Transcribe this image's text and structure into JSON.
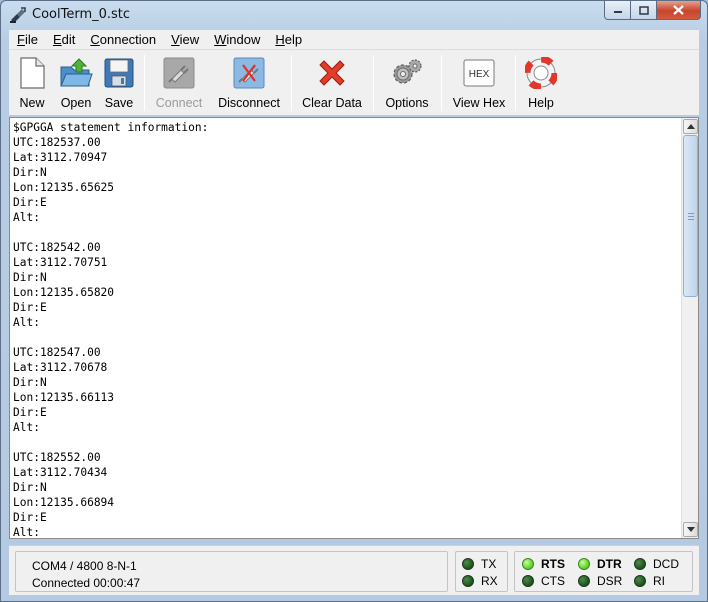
{
  "window": {
    "title": "CoolTerm_0.stc"
  },
  "menu": [
    {
      "underline": "F",
      "rest": "ile"
    },
    {
      "underline": "E",
      "rest": "dit"
    },
    {
      "underline": "C",
      "rest": "onnection"
    },
    {
      "underline": "V",
      "rest": "iew"
    },
    {
      "underline": "W",
      "rest": "indow"
    },
    {
      "underline": "H",
      "rest": "elp"
    }
  ],
  "toolbar": {
    "new": "New",
    "open": "Open",
    "save": "Save",
    "connect": "Connect",
    "disconnect": "Disconnect",
    "clear_data": "Clear Data",
    "options": "Options",
    "view_hex": "View Hex",
    "view_hex_icon_text": "HEX",
    "help": "Help"
  },
  "terminal": {
    "text": "$GPGGA statement information:\nUTC:182537.00\nLat:3112.70947\nDir:N\nLon:12135.65625\nDir:E\nAlt:\n\nUTC:182542.00\nLat:3112.70751\nDir:N\nLon:12135.65820\nDir:E\nAlt:\n\nUTC:182547.00\nLat:3112.70678\nDir:N\nLon:12135.66113\nDir:E\nAlt:\n\nUTC:182552.00\nLat:3112.70434\nDir:N\nLon:12135.66894\nDir:E\nAlt:"
  },
  "status": {
    "port": "COM4 / 4800 8-N-1",
    "connection": "Connected 00:00:47"
  },
  "leds": {
    "tx": "TX",
    "rx": "RX",
    "rts": "RTS",
    "cts": "CTS",
    "dtr": "DTR",
    "dsr": "DSR",
    "dcd": "DCD",
    "ri": "RI"
  }
}
